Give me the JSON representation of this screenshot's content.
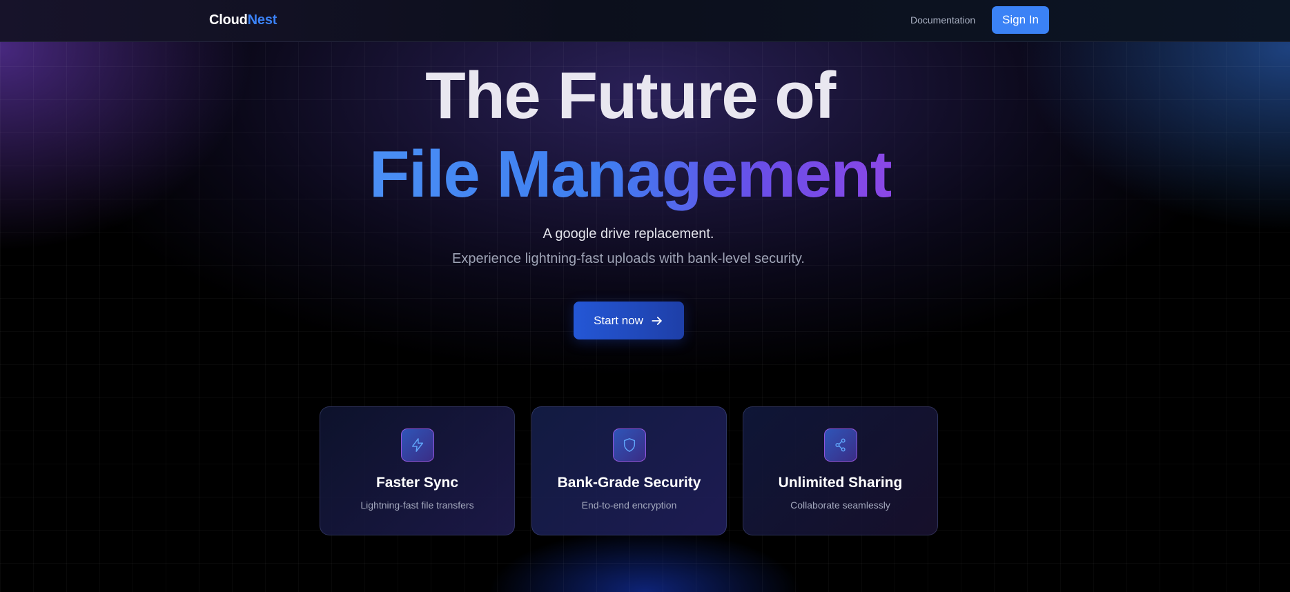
{
  "header": {
    "logo_part1": "Cloud",
    "logo_part2": "Nest",
    "nav_link": "Documentation",
    "signin_label": "Sign In"
  },
  "hero": {
    "title_line1": "The Future of",
    "title_line2": "File Management",
    "tagline": "A google drive replacement.",
    "subtagline": "Experience lightning-fast uploads with bank-level security.",
    "cta_label": "Start now",
    "cta_icon": "arrow-right-icon"
  },
  "features": [
    {
      "icon": "lightning-icon",
      "title": "Faster Sync",
      "description": "Lightning-fast file transfers"
    },
    {
      "icon": "shield-icon",
      "title": "Bank-Grade Security",
      "description": "End-to-end encryption"
    },
    {
      "icon": "share-icon",
      "title": "Unlimited Sharing",
      "description": "Collaborate seamlessly"
    }
  ],
  "colors": {
    "accent": "#3b82f6",
    "gradient_start": "#4a8ff5",
    "gradient_end": "#8b47e6",
    "cta": "#2457d6"
  }
}
